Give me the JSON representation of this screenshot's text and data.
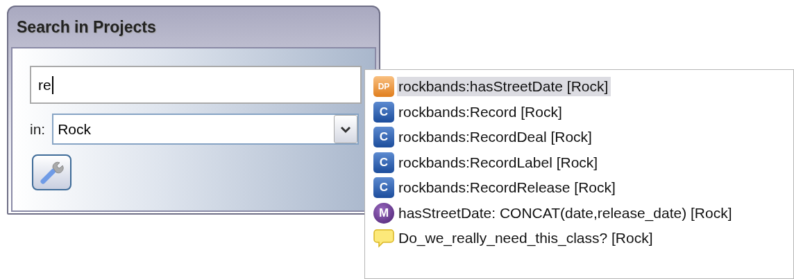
{
  "dialog": {
    "title": "Search in Projects",
    "query": "re",
    "scope_label": "in:",
    "scope_value": "Rock"
  },
  "suggestions": [
    {
      "kind": "property",
      "badge": "DP",
      "label": "rockbands:hasStreetDate [Rock]",
      "selected": true
    },
    {
      "kind": "class",
      "badge": "C",
      "label": "rockbands:Record [Rock]",
      "selected": false
    },
    {
      "kind": "class",
      "badge": "C",
      "label": "rockbands:RecordDeal [Rock]",
      "selected": false
    },
    {
      "kind": "class",
      "badge": "C",
      "label": "rockbands:RecordLabel [Rock]",
      "selected": false
    },
    {
      "kind": "class",
      "badge": "C",
      "label": "rockbands:RecordRelease [Rock]",
      "selected": false
    },
    {
      "kind": "macro",
      "badge": "M",
      "label": "hasStreetDate: CONCAT(date,release_date) [Rock]",
      "selected": false
    },
    {
      "kind": "comment",
      "label": "Do_we_really_need_this_class? [Rock]",
      "selected": false
    }
  ]
}
